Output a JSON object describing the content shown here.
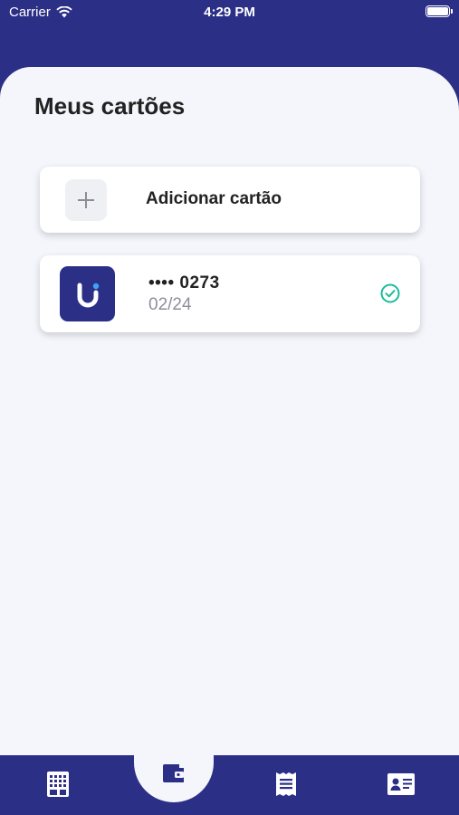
{
  "status": {
    "carrier": "Carrier",
    "time": "4:29 PM"
  },
  "page": {
    "title": "Meus cartões"
  },
  "add_card": {
    "label": "Adicionar cartão",
    "icon": "plus-icon"
  },
  "cards": [
    {
      "number": "•••• 0273",
      "expiry": "02/24",
      "selected": true,
      "logo": "card-brand-logo"
    }
  ],
  "tabs": [
    {
      "name": "catalog",
      "icon": "building-icon",
      "active": false
    },
    {
      "name": "wallet",
      "icon": "wallet-icon",
      "active": true
    },
    {
      "name": "receipts",
      "icon": "receipt-icon",
      "active": false
    },
    {
      "name": "profile",
      "icon": "id-card-icon",
      "active": false
    }
  ],
  "colors": {
    "primary": "#2b2f86",
    "background": "#f4f6fb",
    "check": "#1abc9c",
    "logo_dot": "#3fa3f7"
  }
}
